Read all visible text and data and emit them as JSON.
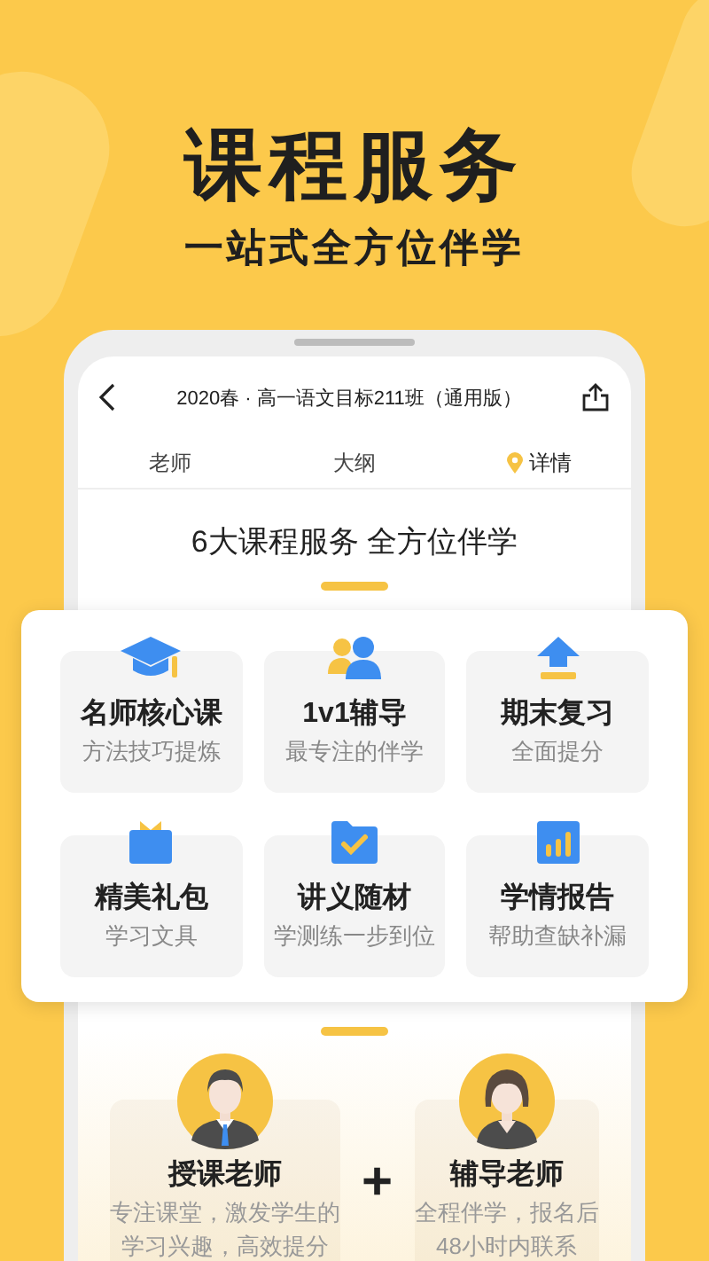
{
  "hero": {
    "title": "课程服务",
    "subtitle": "一站式全方位伴学"
  },
  "screen": {
    "title": "2020春 · 高一语文目标211班（通用版）",
    "heading": "6大课程服务 全方位伴学",
    "tabs": [
      {
        "label": "老师",
        "selected": false
      },
      {
        "label": "大纲",
        "selected": false
      },
      {
        "label": "详情",
        "selected": true
      }
    ]
  },
  "services": [
    {
      "kind": "cap",
      "title": "名师核心课",
      "subtitle": "方法技巧提炼"
    },
    {
      "kind": "people",
      "title": "1v1辅导",
      "subtitle": "最专注的伴学"
    },
    {
      "kind": "upload",
      "title": "期末复习",
      "subtitle": "全面提分"
    },
    {
      "kind": "gift",
      "title": "精美礼包",
      "subtitle": "学习文具"
    },
    {
      "kind": "folder",
      "title": "讲义随材",
      "subtitle": "学测练一步到位"
    },
    {
      "kind": "chart",
      "title": "学情报告",
      "subtitle": "帮助查缺补漏"
    }
  ],
  "teachers": [
    {
      "kind": "male",
      "title": "授课老师",
      "lines": [
        "专注课堂，激发学生的",
        "学习兴趣，高效提分"
      ]
    },
    {
      "kind": "female",
      "title": "辅导老师",
      "lines": [
        "全程伴学，报名后",
        "48小时内联系"
      ]
    }
  ],
  "connector": "+"
}
